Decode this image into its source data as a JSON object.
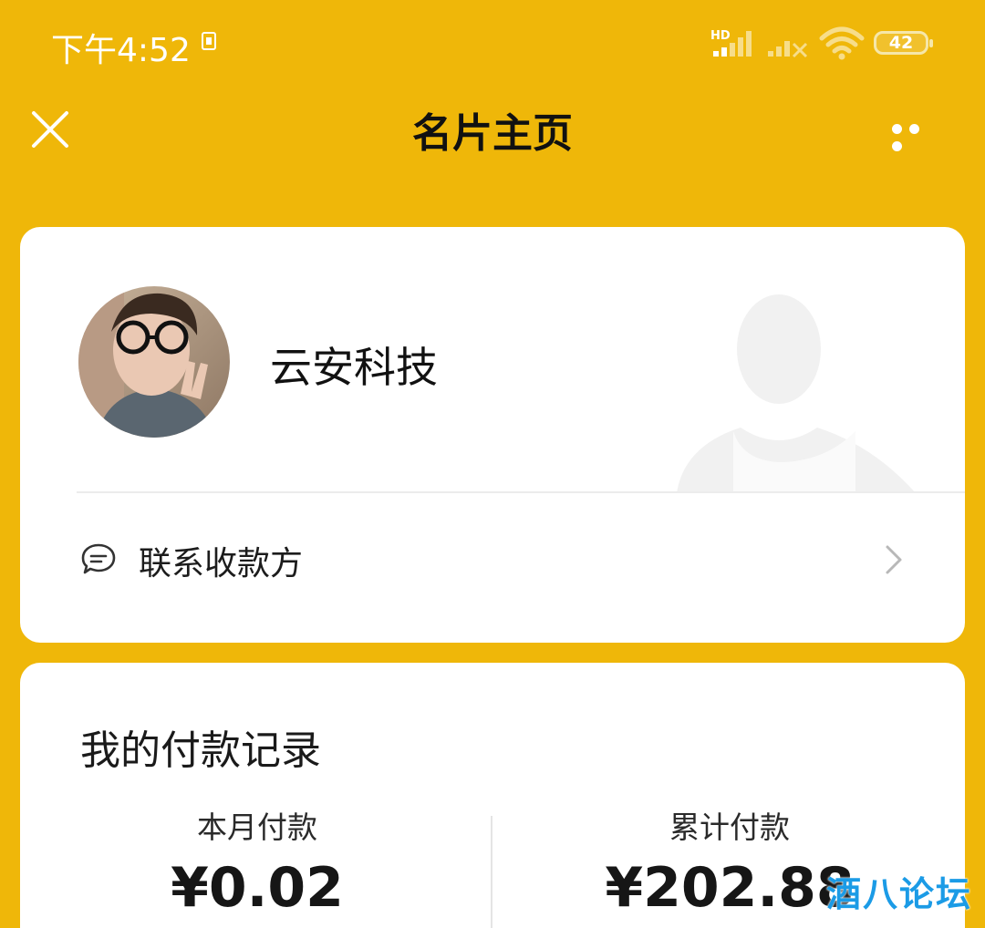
{
  "status_bar": {
    "time": "下午4:52",
    "signal_label": "HD",
    "battery_level": "42"
  },
  "nav": {
    "title": "名片主页"
  },
  "profile": {
    "merchant_name": "云安科技",
    "contact_label": "联系收款方"
  },
  "records": {
    "title": "我的付款记录",
    "month_label": "本月付款",
    "month_value": "¥0.02",
    "total_label": "累计付款",
    "total_value": "¥202.88"
  },
  "watermark": {
    "text": "酒八论坛"
  },
  "colors": {
    "background": "#efb709",
    "card": "#ffffff",
    "watermark": "#1b9be6"
  }
}
